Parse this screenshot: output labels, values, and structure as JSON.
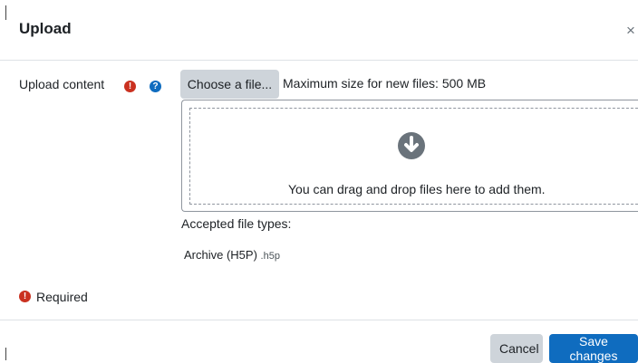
{
  "dialog": {
    "title": "Upload",
    "close_glyph": "×"
  },
  "form": {
    "upload_label": "Upload content",
    "required_icon": "exclamation-circle-icon",
    "help_icon": "question-circle-icon",
    "choose_file_label": "Choose a file...",
    "max_size_text": "Maximum size for new files: 500 MB",
    "dropzone_text": "You can drag and drop files here to add them.",
    "dropzone_icon": "arrow-circle-down-icon",
    "accepted_label": "Accepted file types:",
    "accepted_types": [
      {
        "name": "Archive (H5P)",
        "extension": ".h5p"
      }
    ],
    "required_legend": "Required"
  },
  "footer": {
    "cancel_label": "Cancel",
    "save_label": "Save changes"
  },
  "colors": {
    "primary": "#0f6cbf",
    "required": "#ca3120",
    "secondary_button": "#ced4da"
  }
}
